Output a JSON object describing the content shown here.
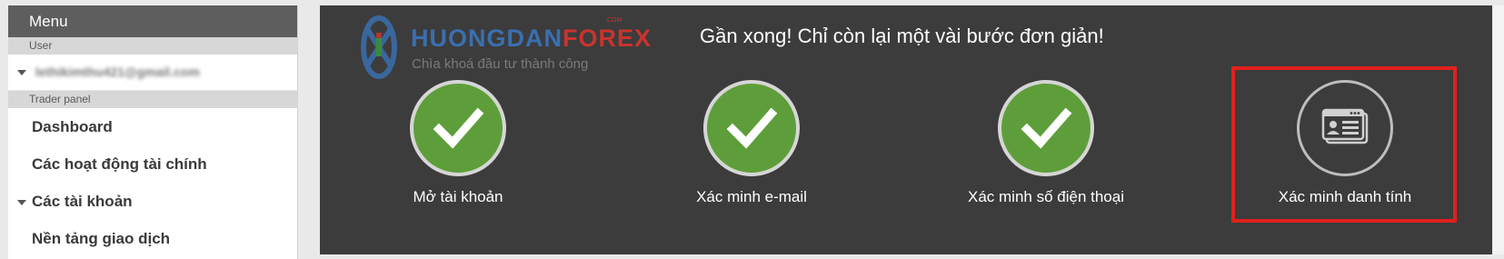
{
  "sidebar": {
    "menu_title": "Menu",
    "user_section": "User",
    "user_email": "lethikimthu421@gmail.com",
    "trader_section": "Trader panel",
    "items": [
      {
        "label": "Dashboard"
      },
      {
        "label": "Các hoạt động tài chính"
      },
      {
        "label": "Các tài khoản"
      },
      {
        "label": "Nền tảng giao dịch"
      }
    ]
  },
  "logo": {
    "brand_blue": "HUONGDAN",
    "brand_red": "FOREX",
    "domain_suffix": ".COM",
    "tagline": "Chìa khoá đầu tư thành công"
  },
  "main": {
    "headline": "Gần xong! Chỉ còn lại một vài bước đơn giản!",
    "steps": [
      {
        "label": "Mở tài khoản",
        "status": "done",
        "icon": "checkmark-icon"
      },
      {
        "label": "Xác minh e-mail",
        "status": "done",
        "icon": "checkmark-icon"
      },
      {
        "label": "Xác minh số điện thoại",
        "status": "done",
        "icon": "checkmark-icon"
      },
      {
        "label": "Xác minh danh tính",
        "status": "todo",
        "icon": "id-card-icon"
      }
    ]
  },
  "colors": {
    "panel_bg": "#3c3c3c",
    "done_green": "#5e9e3a",
    "highlight_red": "#e0211d",
    "sidebar_header": "#5e5e5e"
  }
}
